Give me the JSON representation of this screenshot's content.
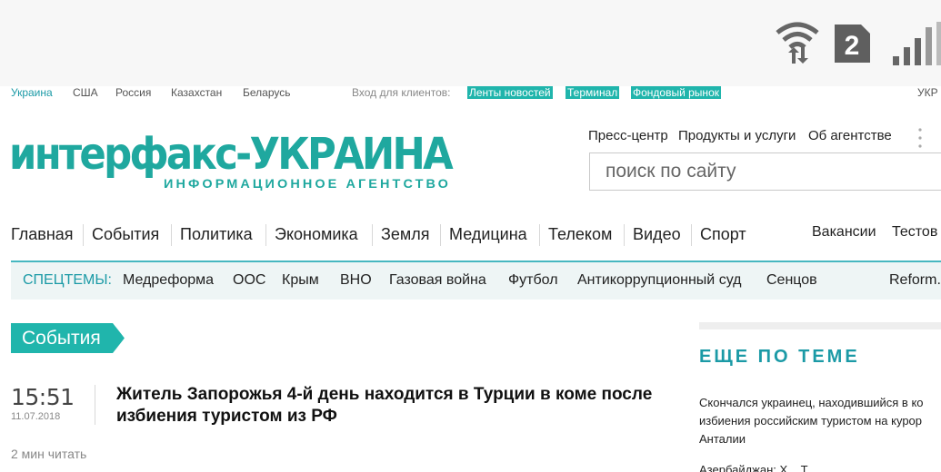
{
  "status_bar": {
    "sim_number": "2",
    "icons": [
      "wifi-data-icon",
      "sim-2-icon",
      "signal-strength-icon"
    ]
  },
  "top_links": {
    "countries": [
      "Украина",
      "США",
      "Россия",
      "Казахстан",
      "Беларусь"
    ],
    "client_label": "Вход для клиентов:",
    "client_links": [
      "Ленты новостей",
      "Терминал",
      "Фондовый рынок"
    ],
    "language": "УКР"
  },
  "logo": {
    "brand": "интерфакс-УКРАИНА",
    "tagline": "ИНФОРМАЦИОННОЕ АГЕНТСТВО"
  },
  "header_nav": [
    "Пресс-центр",
    "Продукты и услуги",
    "Об агентстве"
  ],
  "search": {
    "placeholder": "поиск по сайту"
  },
  "main_nav": [
    "Главная",
    "События",
    "Политика",
    "Экономика",
    "Земля",
    "Медицина",
    "Телеком",
    "Видео",
    "Спорт"
  ],
  "main_nav_right": [
    "Вакансии",
    "Тестов"
  ],
  "special_topics": {
    "label": "СПЕЦТЕМЫ:",
    "items": [
      "Медреформа",
      "ООС",
      "Крым",
      "ВНО",
      "Газовая война",
      "Футбол",
      "Антикоррупционный суд",
      "Сенцов",
      "Reform."
    ]
  },
  "section": {
    "label": "События"
  },
  "article": {
    "time": "15:51",
    "date": "11.07.2018",
    "headline": "Житель Запорожья 4-й день находится в Турции в коме после избиения туристом из РФ",
    "read_time": "2 мин читать"
  },
  "sidebar": {
    "title": "ЕЩЕ ПО ТЕМЕ",
    "items": [
      "Скончался украинец, находившийся в ко избиения российским туристом на курор Анталии",
      "Азербайджан: Х... Т..."
    ]
  },
  "colors": {
    "accent": "#1b9aa6",
    "highlight": "#20b5ac",
    "logo": "#1fa89f"
  }
}
